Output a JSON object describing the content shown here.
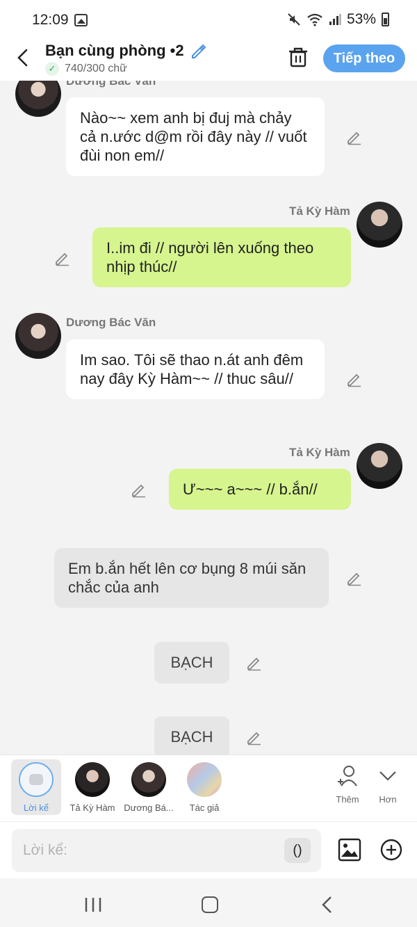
{
  "status": {
    "time": "12:09",
    "battery": "53%"
  },
  "header": {
    "title": "Bạn cùng phòng •2",
    "word_count": "740/300 chữ",
    "next_label": "Tiếp theo"
  },
  "messages": [
    {
      "speaker": "Dương Bác Văn",
      "text": "Nào~~ xem anh bị đuj mà chảy cả n.ước d@m rồi đây này // vuốt đùi non em//"
    },
    {
      "speaker": "Tả Kỳ Hàm",
      "text": "I..im đi // người lên xuống theo nhịp thúc//"
    },
    {
      "speaker": "Dương Bác Văn",
      "text": "Im sao. Tôi sẽ thao n.át anh đêm nay đây Kỳ Hàm~~ // thuc sâu//"
    },
    {
      "speaker": "Tả Kỳ Hàm",
      "text": "Ư~~~ a~~~ // b.ắn//"
    },
    {
      "speaker": "narration",
      "text": "Em b.ắn hết lên cơ bụng 8 múi săn chắc của anh"
    }
  ],
  "chips": [
    "BẠCH",
    "BẠCH"
  ],
  "characters": [
    {
      "label": "Lời kể",
      "selected": true
    },
    {
      "label": "Tả Kỳ Hàm"
    },
    {
      "label": "Dương Bá..."
    },
    {
      "label": "Tác giả"
    }
  ],
  "actions": {
    "add_label": "Thêm",
    "more_label": "Hơn"
  },
  "input": {
    "placeholder": "Lời kể:",
    "paren_label": "()"
  },
  "colors": {
    "accent": "#5aa3ee",
    "green_bubble": "#d6f58e"
  }
}
